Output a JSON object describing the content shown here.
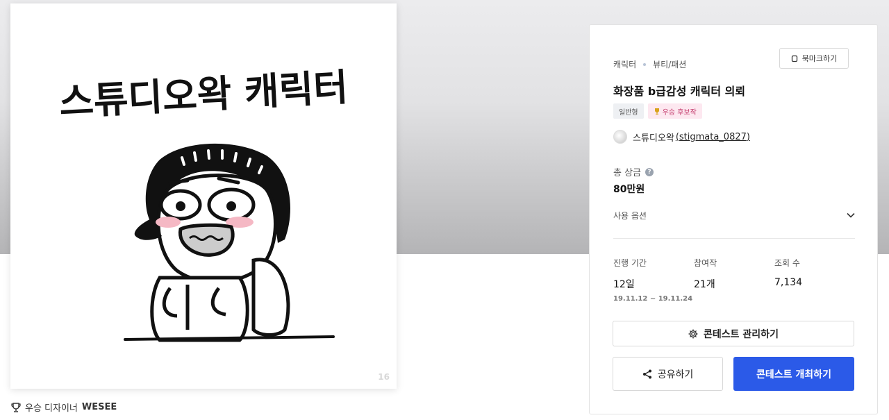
{
  "artwork": {
    "headline": "스튜디오왁 캐릭터",
    "page_number": "16"
  },
  "winner": {
    "prefix": "우승 디자이너",
    "name": "WESEE"
  },
  "contest": {
    "category": "캐릭터",
    "subcategory": "뷰티/패션",
    "bookmark_label": "북마크하기",
    "title": "화장품 b급감성 캐릭터 의뢰",
    "badges": [
      "일반형",
      "우승 후보작"
    ],
    "author_name": "스튜디오왁",
    "author_handle": "(stigmata_0827)",
    "prize_label": "총 상금",
    "prize_value": "80만원",
    "options_label": "사용 옵션",
    "stats": {
      "period_label": "진행 기간",
      "period_value": "12일",
      "period_dates": "19.11.12 ~ 19.11.24",
      "entries_label": "참여작",
      "entries_value": "21개",
      "views_label": "조회 수",
      "views_value": "7,134"
    },
    "manage_label": "콘테스트 관리하기",
    "share_label": "공유하기",
    "host_label": "콘테스트 개최하기"
  },
  "icons": {
    "trophy": "trophy-icon",
    "bookmark": "bookmark-icon",
    "help": "help-icon",
    "chevron": "chevron-down-icon",
    "gear": "gear-icon",
    "share": "share-icon"
  },
  "colors": {
    "primary": "#2b5ae8",
    "pink_badge_text": "#c33a6b",
    "pink_badge_bg": "#fde8f0"
  }
}
